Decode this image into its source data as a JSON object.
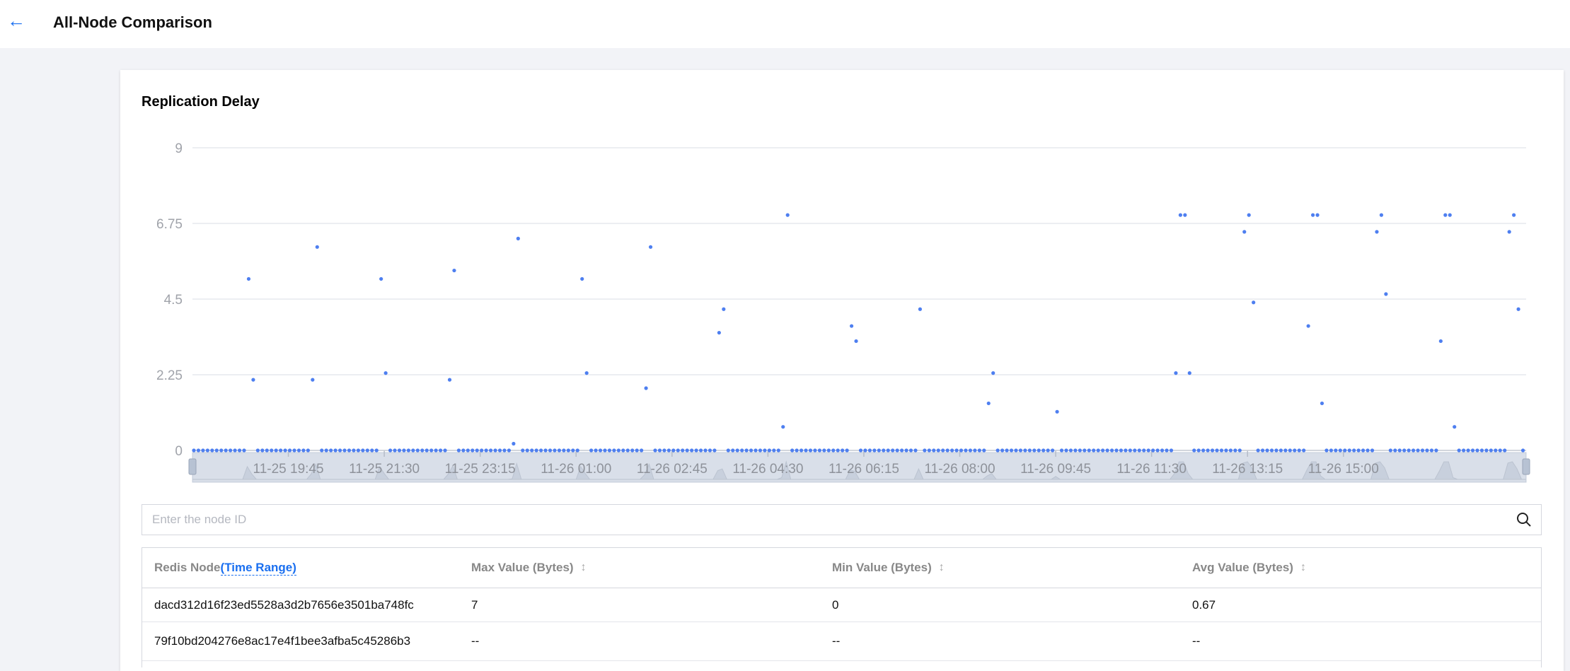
{
  "header": {
    "back_icon": "arrow-left-icon",
    "title": "All-Node Comparison"
  },
  "card": {
    "title": "Replication Delay"
  },
  "chart_data": {
    "type": "scatter",
    "title": "Replication Delay",
    "xlabel": "",
    "ylabel": "",
    "ylim": [
      0,
      9
    ],
    "y_ticks": [
      "0",
      "2.25",
      "4.5",
      "6.75",
      "9"
    ],
    "x_ticks": [
      "11-25 19:45",
      "11-25 21:30",
      "11-25 23:15",
      "11-26 01:00",
      "11-26 02:45",
      "11-26 04:30",
      "11-26 06:15",
      "11-26 08:00",
      "11-26 09:45",
      "11-26 11:30",
      "11-26 13:15",
      "11-26 15:00"
    ],
    "x_start": "11-25 18:00",
    "x_interval_minutes": 5,
    "grid": true,
    "color": "#4e7ff0",
    "values": [
      0,
      0,
      0,
      0,
      0,
      0,
      0,
      0,
      0,
      0,
      0,
      0,
      5.1,
      2.1,
      0,
      0,
      0,
      0,
      0,
      0,
      0,
      0,
      0,
      0,
      0,
      0,
      2.1,
      6.05,
      0,
      0,
      0,
      0,
      0,
      0,
      0,
      0,
      0,
      0,
      0,
      0,
      0,
      5.1,
      2.3,
      0,
      0,
      0,
      0,
      0,
      0,
      0,
      0,
      0,
      0,
      0,
      0,
      0,
      2.1,
      5.35,
      0,
      0,
      0,
      0,
      0,
      0,
      0,
      0,
      0,
      0,
      0,
      0,
      0.2,
      6.3,
      0,
      0,
      0,
      0,
      0,
      0,
      0,
      0,
      0,
      0,
      0,
      0,
      0,
      5.1,
      2.3,
      0,
      0,
      0,
      0,
      0,
      0,
      0,
      0,
      0,
      0,
      0,
      0,
      1.85,
      6.05,
      0,
      0,
      0,
      0,
      0,
      0,
      0,
      0,
      0,
      0,
      0,
      0,
      0,
      0,
      3.5,
      4.2,
      0,
      0,
      0,
      0,
      0,
      0,
      0,
      0,
      0,
      0,
      0,
      0,
      0.7,
      7,
      0,
      0,
      0,
      0,
      0,
      0,
      0,
      0,
      0,
      0,
      0,
      0,
      0,
      3.7,
      3.25,
      0,
      0,
      0,
      0,
      0,
      0,
      0,
      0,
      0,
      0,
      0,
      0,
      0,
      4.2,
      0,
      0,
      0,
      0,
      0,
      0,
      0,
      0,
      0,
      0,
      0,
      0,
      0,
      0,
      1.4,
      2.3,
      0,
      0,
      0,
      0,
      0,
      0,
      0,
      0,
      0,
      0,
      0,
      0,
      0,
      1.15,
      0,
      0,
      0,
      0,
      0,
      0,
      0,
      0,
      0,
      0,
      0,
      0,
      0,
      0,
      0,
      0,
      0,
      0,
      0,
      0,
      0,
      0,
      0,
      0,
      0,
      2.3,
      7,
      7,
      2.3,
      0,
      0,
      0,
      0,
      0,
      0,
      0,
      0,
      0,
      0,
      0,
      6.5,
      7,
      4.4,
      0,
      0,
      0,
      0,
      0,
      0,
      0,
      0,
      0,
      0,
      0,
      3.7,
      7,
      7,
      1.4,
      0,
      0,
      0,
      0,
      0,
      0,
      0,
      0,
      0,
      0,
      0,
      6.5,
      7,
      4.65,
      0,
      0,
      0,
      0,
      0,
      0,
      0,
      0,
      0,
      0,
      0,
      3.25,
      7,
      7,
      0.7,
      0,
      0,
      0,
      0,
      0,
      0,
      0,
      0,
      0,
      0,
      0,
      6.5,
      7,
      4.2,
      0
    ],
    "data_zoom": {
      "start_percent": 0,
      "end_percent": 100
    }
  },
  "search": {
    "placeholder": "Enter the node ID",
    "value": "",
    "icon": "search-icon"
  },
  "table": {
    "headers": {
      "node": "Redis Node",
      "time_range": "(Time Range)",
      "max": "Max Value (Bytes)",
      "min": "Min Value (Bytes)",
      "avg": "Avg Value (Bytes)"
    },
    "sort_icon": "↕",
    "rows": [
      {
        "node": "dacd312d16f23ed5528a3d2b7656e3501ba748fc",
        "max": "7",
        "min": "0",
        "avg": "0.67"
      },
      {
        "node": "79f10bd204276e8ac17e4f1bee3afba5c45286b3",
        "max": "--",
        "min": "--",
        "avg": "--"
      }
    ]
  }
}
